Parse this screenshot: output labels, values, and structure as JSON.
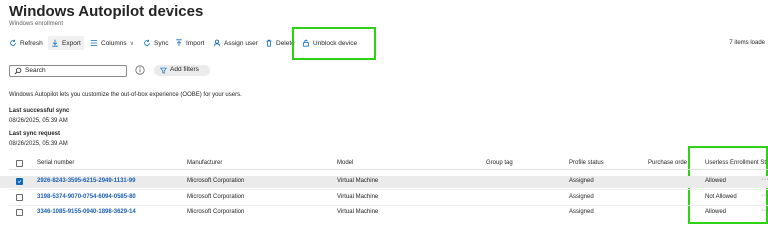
{
  "page": {
    "title": "Windows Autopilot devices",
    "more_label": "···",
    "subtitle": "Windows enrollment"
  },
  "toolbar": {
    "refresh": "Refresh",
    "export": "Export",
    "columns": "Columns",
    "sync": "Sync",
    "import": "Import",
    "assign_user": "Assign user",
    "delete": "Delete",
    "unblock_device": "Unblock device",
    "items_loaded": "7 items loade"
  },
  "search": {
    "placeholder": "Search"
  },
  "filters": {
    "add_filters": "Add filters"
  },
  "description": "Windows Autopilot lets you customize the out-of-box experience (OOBE) for your users.",
  "sync": {
    "last_successful_label": "Last successful sync",
    "last_successful_value": "08/26/2025, 05:39 AM",
    "last_request_label": "Last sync request",
    "last_request_value": "08/26/2025, 05:39 AM"
  },
  "table": {
    "columns": {
      "serial": "Serial number",
      "manufacturer": "Manufacturer",
      "model": "Model",
      "group_tag": "Group tag",
      "profile_status": "Profile status",
      "purchase_order": "Purchase orde",
      "userless": "Userless Enrollment St"
    },
    "rows": [
      {
        "serial": "2926-8243-3595-6215-2949-1131-99",
        "manufacturer": "Microsoft Corporation",
        "model": "Virtual Machine",
        "group_tag": "",
        "profile_status": "Assigned",
        "purchase_order": "",
        "userless": "Allowed",
        "selected": true
      },
      {
        "serial": "3198-5374-9070-0754-6094-0585-80",
        "manufacturer": "Microsoft Corporation",
        "model": "Virtual Machine",
        "group_tag": "",
        "profile_status": "Assigned",
        "purchase_order": "",
        "userless": "Not Allowed",
        "selected": false
      },
      {
        "serial": "3346-1085-9155-0940-1898-3629-14",
        "manufacturer": "Microsoft Corporation",
        "model": "Virtual Machine",
        "group_tag": "",
        "profile_status": "Assigned",
        "purchase_order": "",
        "userless": "Allowed",
        "selected": false
      }
    ],
    "row_more": "···"
  },
  "colors": {
    "accent": "#0f6cbd",
    "highlight": "#2bd312",
    "selected_row": "#ebebeb"
  }
}
